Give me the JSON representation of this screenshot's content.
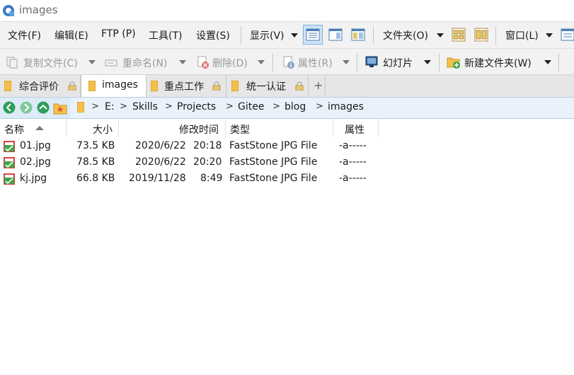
{
  "window": {
    "title": "images"
  },
  "menu": {
    "file": "文件(F)",
    "edit": "编辑(E)",
    "ftp": "FTP (P)",
    "tools": "工具(T)",
    "settings": "设置(S)",
    "view": "显示(V)",
    "folder": "文件夹(O)",
    "window": "窗口(L)"
  },
  "toolbar": {
    "copy": "复制文件(C)",
    "rename": "重命名(N)",
    "delete": "删除(D)",
    "properties": "属性(R)",
    "slideshow": "幻灯片",
    "new_folder": "新建文件夹(W)"
  },
  "tabs": [
    {
      "label": "综合评价",
      "locked": true,
      "active": false
    },
    {
      "label": "images",
      "locked": false,
      "active": true
    },
    {
      "label": "重点工作",
      "locked": true,
      "active": false
    },
    {
      "label": "统一认证",
      "locked": true,
      "active": false
    }
  ],
  "tab_add": "+",
  "breadcrumb": [
    "E:",
    "Skills",
    "Projects",
    "Gitee",
    "blog",
    "images"
  ],
  "breadcrumb_sep": ">",
  "columns": {
    "name": "名称",
    "size": "大小",
    "modified": "修改时间",
    "type": "类型",
    "attributes": "属性"
  },
  "files": [
    {
      "name": "01.jpg",
      "size": "73.5 KB",
      "date": "2020/6/22",
      "time": "20:18",
      "type": "FastStone JPG File",
      "attr": "-a-----"
    },
    {
      "name": "02.jpg",
      "size": "78.5 KB",
      "date": "2020/6/22",
      "time": "20:20",
      "type": "FastStone JPG File",
      "attr": "-a-----"
    },
    {
      "name": "kj.jpg",
      "size": "66.8 KB",
      "date": "2019/11/28",
      "time": "8:49",
      "type": "FastStone JPG File",
      "attr": "-a-----"
    }
  ],
  "colors": {
    "accent": "#cfe3f7",
    "pathbar": "#dcebf7",
    "folder": "#f3c04b"
  }
}
